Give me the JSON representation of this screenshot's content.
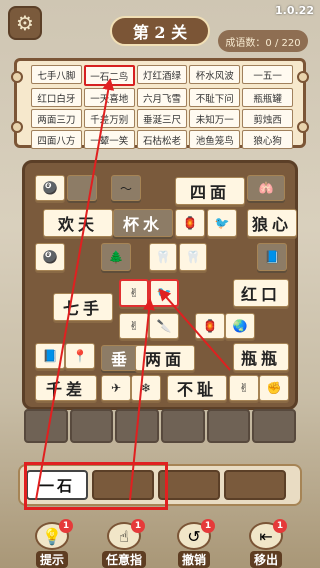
{
  "header": {
    "version": "1.0.22",
    "level_title": "第 2 关",
    "idiom_count": "成语数：0 / 220"
  },
  "idiom_board": {
    "rows": [
      [
        "七手八脚",
        "一石二鸟",
        "灯红酒绿",
        "杯水风波",
        "一五一"
      ],
      [
        "红口白牙",
        "一天喜地",
        "六月飞雪",
        "不耻下问",
        "瓶瓶罐"
      ],
      [
        "两面三刀",
        "千差万别",
        "垂涎三尺",
        "未知万一",
        "剪烛西"
      ],
      [
        "四面八方",
        "一颦一笑",
        "石枯松老",
        "池鱼笼鸟",
        "狼心狗"
      ]
    ],
    "active_cell": "一石二鸟"
  },
  "tiles": {
    "t1": "四面",
    "t2": "欢天",
    "t3": "杯水",
    "t4": "狼心",
    "t5": "七手",
    "t6": "红口",
    "t7": "两面",
    "t8": "瓶瓶",
    "t9": "千差",
    "t10": "不耻",
    "t11": "垂"
  },
  "icons": {
    "eight_ball": "🎱",
    "tree": "🌲",
    "tooth": "🦷",
    "lungs": "🫁",
    "bird": "🐦",
    "victory_hand": "✌",
    "fist": "✊",
    "lantern": "🏮",
    "globe": "🌏",
    "pin": "📍",
    "knife": "🔪",
    "snow": "❄",
    "plane": "✈",
    "book": "📘",
    "wave": "〜"
  },
  "empty_slots_count": 6,
  "tray": {
    "slots": [
      "一石",
      "",
      "",
      ""
    ]
  },
  "buttons": {
    "hint": {
      "label": "提示",
      "badge": "1"
    },
    "any_finger": {
      "label": "任意指",
      "badge": "1"
    },
    "undo": {
      "label": "撤销",
      "badge": "1"
    },
    "remove": {
      "label": "移出",
      "badge": "1"
    }
  },
  "colors": {
    "wood": "#7a5a3c",
    "highlight": "#e02020",
    "badge": "#e53a3a"
  }
}
